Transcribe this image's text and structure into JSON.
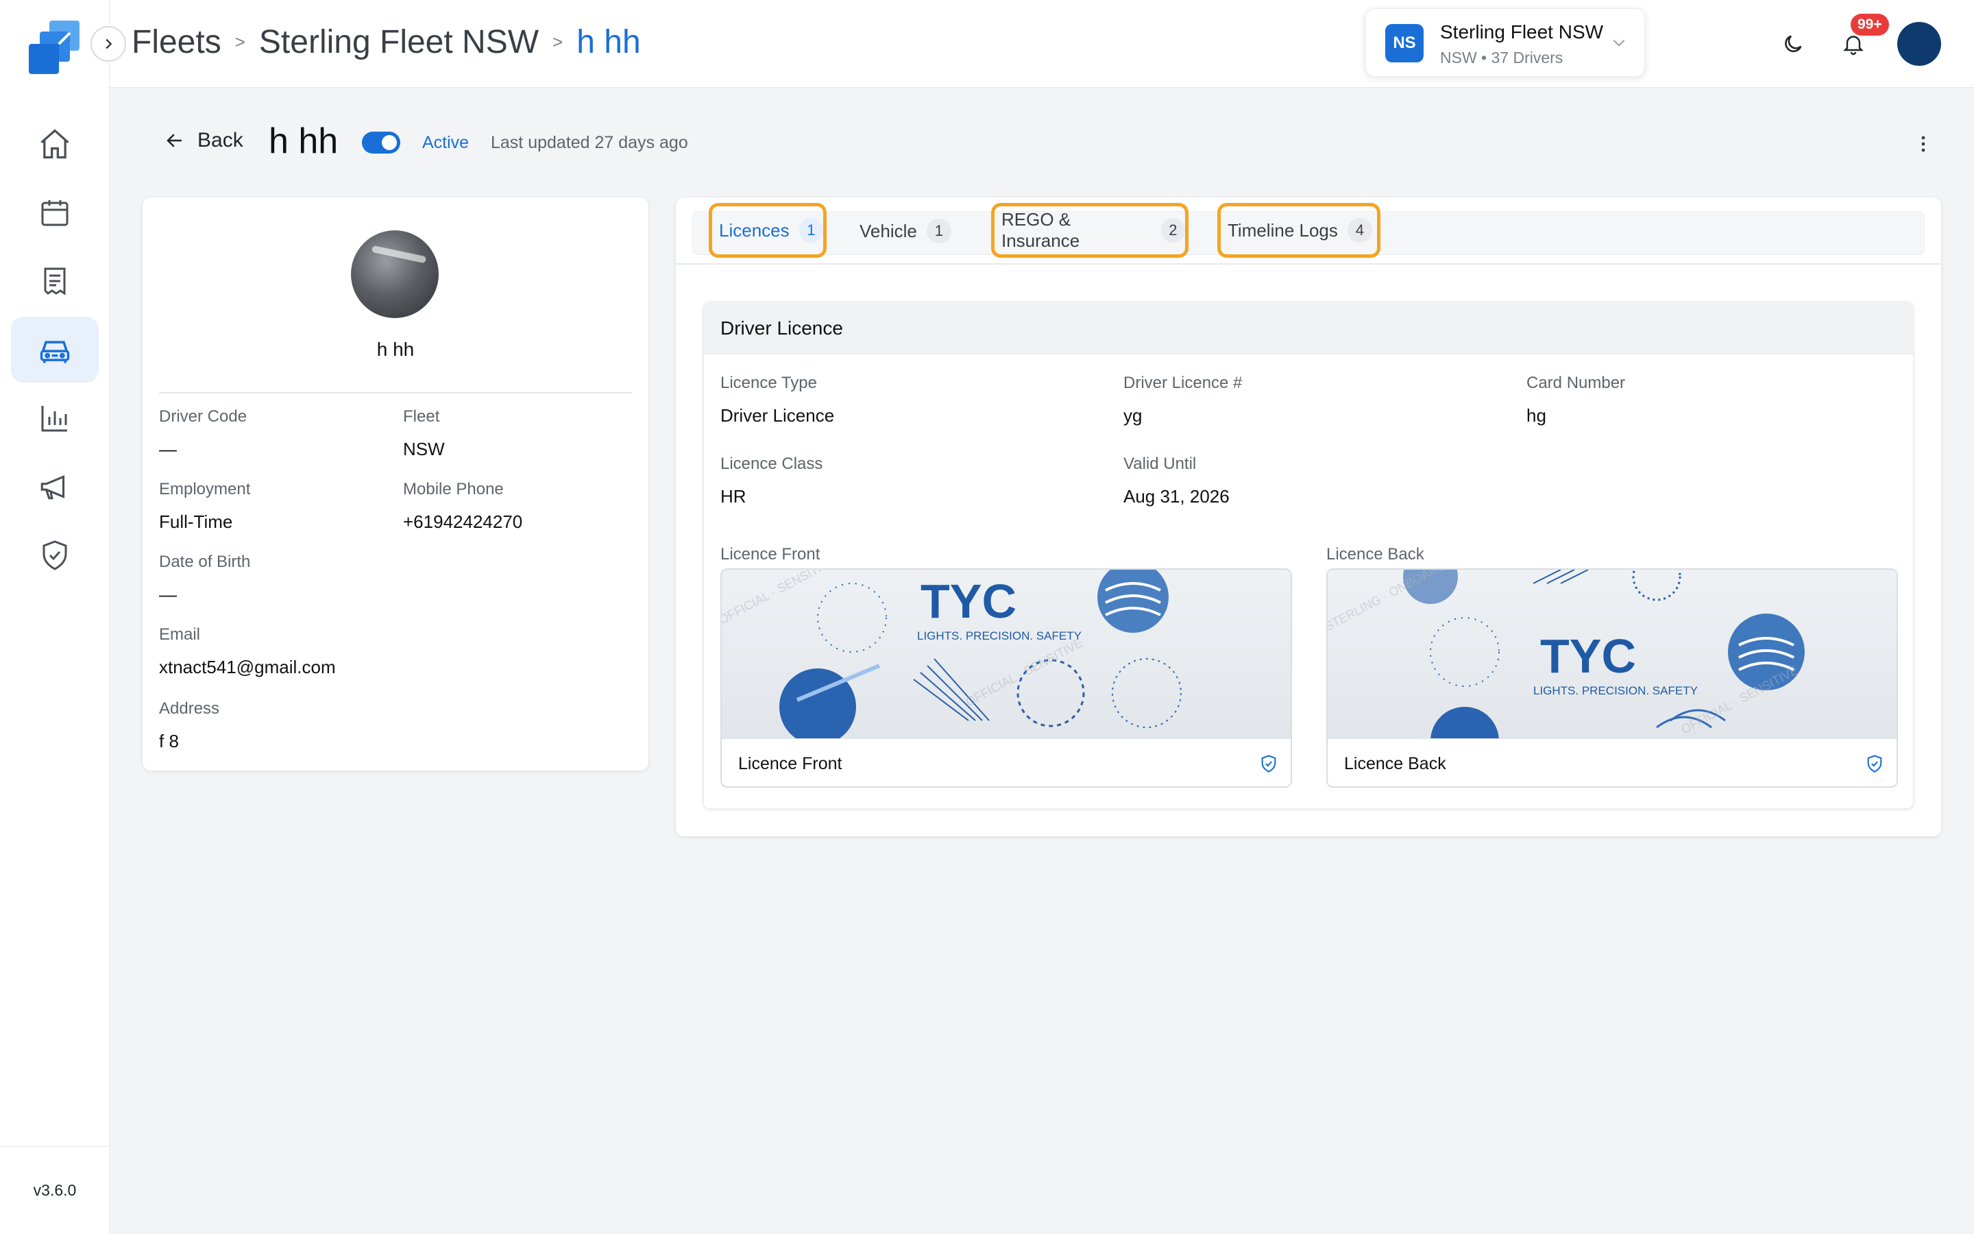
{
  "app": {
    "version": "v3.6.0"
  },
  "breadcrumb": {
    "items": [
      "Fleets",
      "Sterling Fleet NSW"
    ],
    "current": "h hh",
    "separator": ">"
  },
  "fleet_switcher": {
    "badge": "NS",
    "name": "Sterling Fleet NSW",
    "subtitle": "NSW • 37 Drivers"
  },
  "notifications": {
    "badge": "99+"
  },
  "sidebar": {
    "items": [
      {
        "name": "home",
        "icon": "home-icon",
        "active": false
      },
      {
        "name": "calendar",
        "icon": "calendar-icon",
        "active": false
      },
      {
        "name": "documents",
        "icon": "receipt-icon",
        "active": false
      },
      {
        "name": "fleets",
        "icon": "car-icon",
        "active": true
      },
      {
        "name": "reports",
        "icon": "bar-chart-icon",
        "active": false
      },
      {
        "name": "announcements",
        "icon": "megaphone-icon",
        "active": false
      },
      {
        "name": "compliance",
        "icon": "shield-check-icon",
        "active": false
      }
    ]
  },
  "header": {
    "back_label": "Back",
    "driver_name": "h hh",
    "status": "Active",
    "last_updated": "Last updated 27 days ago"
  },
  "profile": {
    "name": "h hh",
    "fields": {
      "driver_code": {
        "label": "Driver Code",
        "value": "—"
      },
      "fleet": {
        "label": "Fleet",
        "value": "NSW"
      },
      "employment": {
        "label": "Employment",
        "value": "Full-Time"
      },
      "mobile": {
        "label": "Mobile Phone",
        "value": "+61942424270"
      },
      "dob": {
        "label": "Date of Birth",
        "value": "—"
      },
      "email": {
        "label": "Email",
        "value": "xtnact541@gmail.com"
      },
      "address": {
        "label": "Address",
        "value": "f 8"
      }
    }
  },
  "tabs": [
    {
      "label": "Licences",
      "count": "1",
      "active": true
    },
    {
      "label": "Vehicle",
      "count": "1",
      "active": false
    },
    {
      "label": "REGO & Insurance",
      "count": "2",
      "active": false
    },
    {
      "label": "Timeline Logs",
      "count": "4",
      "active": false
    }
  ],
  "licence": {
    "title": "Driver Licence",
    "fields": {
      "type": {
        "label": "Licence Type",
        "value": "Driver Licence"
      },
      "number": {
        "label": "Driver Licence #",
        "value": "yg"
      },
      "card": {
        "label": "Card Number",
        "value": "hg"
      },
      "class": {
        "label": "Licence Class",
        "value": "HR"
      },
      "valid": {
        "label": "Valid Until",
        "value": "Aug 31, 2026"
      }
    },
    "front": {
      "section_label": "Licence Front",
      "caption": "Licence Front",
      "brand": "TYC",
      "tagline": "LIGHTS. PRECISION. SAFETY"
    },
    "back": {
      "section_label": "Licence Back",
      "caption": "Licence Back",
      "brand": "TYC",
      "tagline": "LIGHTS. PRECISION. SAFETY"
    }
  },
  "colors": {
    "accent": "#1a6fd6",
    "highlight": "#f4a423",
    "badge": "#ea3b3b"
  }
}
